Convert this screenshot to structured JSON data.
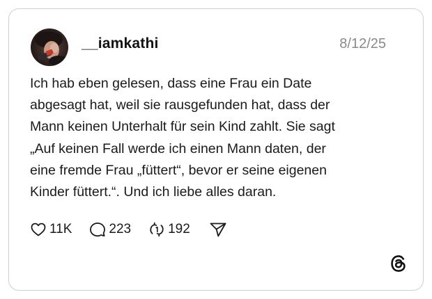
{
  "post": {
    "username": "__iamkathi",
    "timestamp": "8/12/25",
    "text": "Ich hab eben gelesen, dass eine Frau ein Date\nabgesagt hat, weil sie rausgefunden hat, dass der\nMann keinen Unterhalt für sein Kind zahlt. Sie sagt\n„Auf keinen Fall werde ich einen Mann daten, der\neine fremde Frau „füttert“, bevor er seine eigenen\nKinder füttert.“. Und ich liebe alles daran."
  },
  "actions": {
    "likes": "11K",
    "replies": "223",
    "reposts": "192"
  },
  "icons": {
    "like": "heart-icon",
    "reply": "speech-bubble-icon",
    "repost": "repost-arrows-icon",
    "share": "paper-plane-icon",
    "brand": "threads-logo-icon"
  },
  "colors": {
    "text": "#1a1a1a",
    "muted": "#8a8a8a",
    "border": "#cfcfcf"
  }
}
